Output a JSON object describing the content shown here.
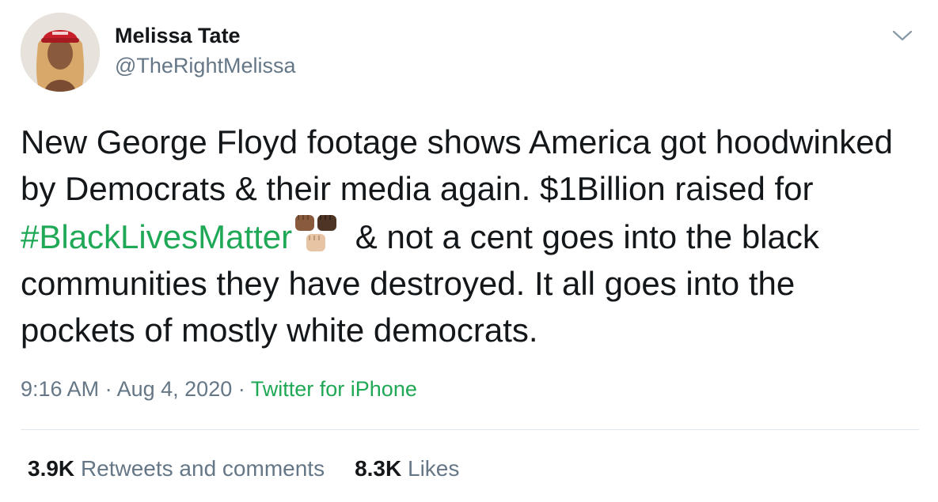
{
  "user": {
    "display_name": "Melissa Tate",
    "handle": "@TheRightMelissa"
  },
  "tweet": {
    "text_1": "New George Floyd footage shows America got hoodwinked by Democrats & their media again. $1Billion raised for ",
    "hashtag": "#BlackLivesMatter",
    "text_2": " & not a cent goes into the black communities they have destroyed. It all goes into the pockets of mostly white democrats."
  },
  "meta": {
    "time": "9:16 AM",
    "separator": "·",
    "date": "Aug 4, 2020",
    "source": "Twitter for iPhone"
  },
  "stats": {
    "retweets_count": "3.9K",
    "retweets_label": "Retweets and comments",
    "likes_count": "8.3K",
    "likes_label": "Likes"
  },
  "icons": {
    "avatar": "profile-photo",
    "menu": "chevron-down-icon",
    "emoji": "raised-fists-emoji"
  },
  "colors": {
    "link": "#1fa855",
    "secondary_text": "#657786",
    "primary_text": "#14171a",
    "divider": "#e1e8ed"
  }
}
